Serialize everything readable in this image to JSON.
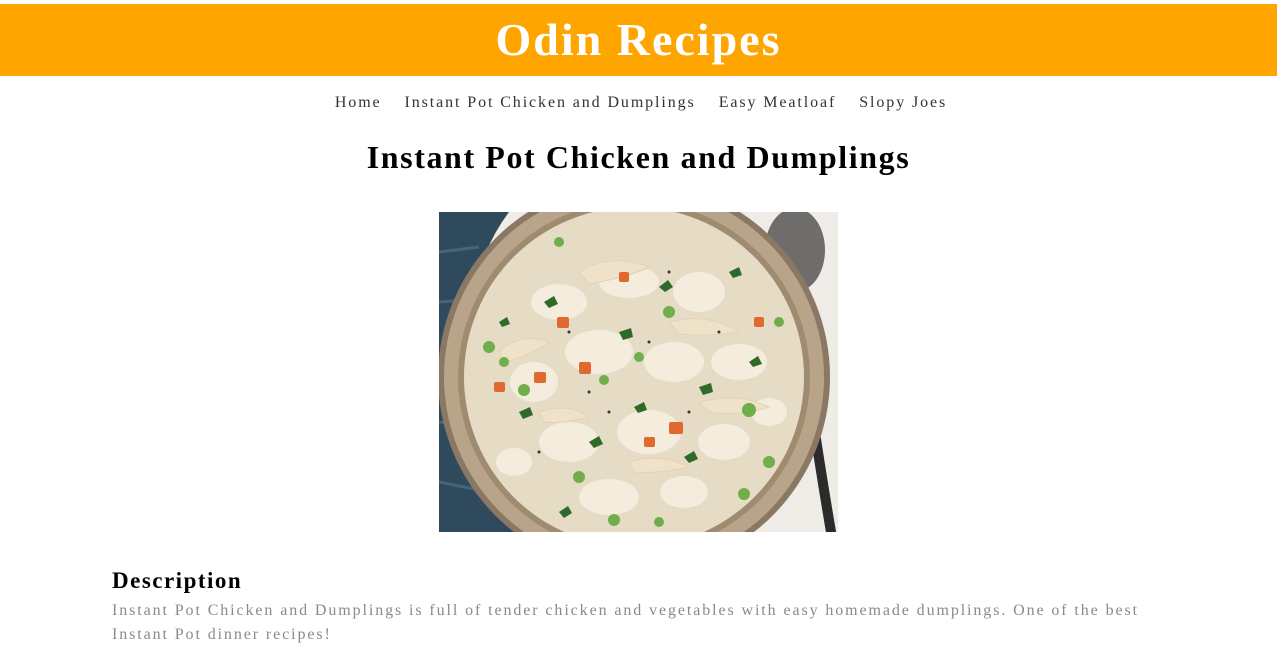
{
  "header": {
    "site_title": "Odin Recipes",
    "background_color": "#ffa500",
    "text_color": "#ffffff"
  },
  "nav": {
    "items": [
      {
        "label": "Home"
      },
      {
        "label": "Instant Pot Chicken and Dumplings"
      },
      {
        "label": "Easy Meatloaf"
      },
      {
        "label": "Slopy Joes"
      }
    ]
  },
  "main": {
    "title": "Instant Pot Chicken and Dumplings",
    "image": {
      "alt": "Instant Pot Chicken and Dumplings"
    },
    "description": {
      "heading": "Description",
      "text": "Instant Pot Chicken and Dumplings is full of tender chicken and vegetables with easy homemade dumplings. One of the best Instant Pot dinner recipes!"
    }
  }
}
